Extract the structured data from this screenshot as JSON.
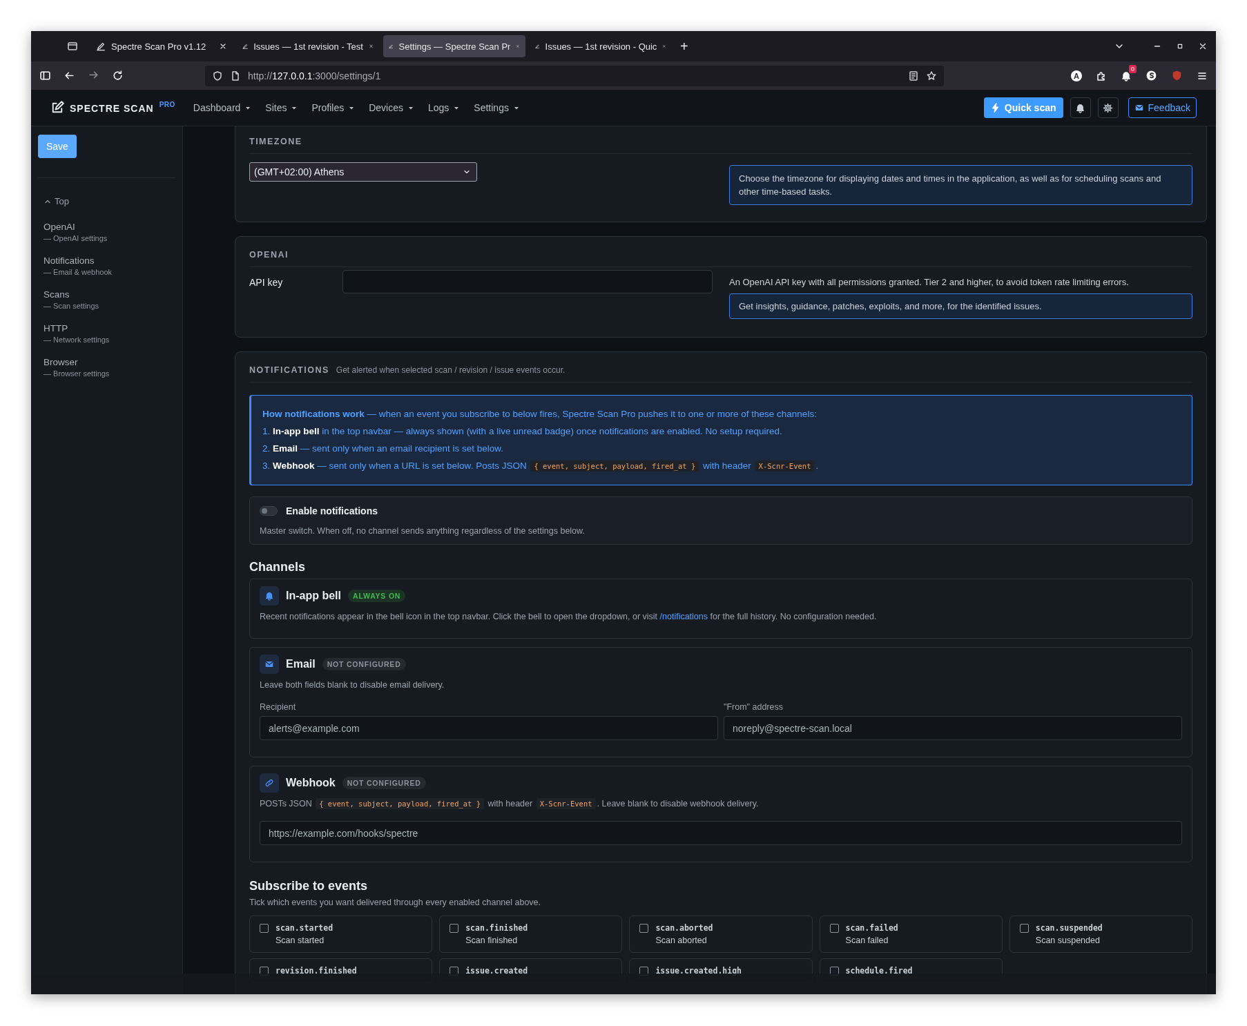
{
  "browser": {
    "tabs": [
      {
        "title": "Spectre Scan Pro v1.12",
        "selected": false
      },
      {
        "title": "Issues — 1st revision - Test",
        "selected": false
      },
      {
        "title": "Settings — Spectre Scan Pr",
        "selected": true
      },
      {
        "title": "Issues — 1st revision - Quic",
        "selected": false
      }
    ],
    "new_tab": "+",
    "url": {
      "scheme": "http://",
      "host": "127.0.0.1",
      "path": ":3000/settings/1"
    },
    "account_initial": "A",
    "extension_badge": "0"
  },
  "navbar": {
    "brand": "SPECTRE SCAN",
    "edition": "PRO",
    "menus": [
      "Dashboard",
      "Sites",
      "Profiles",
      "Devices",
      "Logs",
      "Settings"
    ],
    "quick_scan": "Quick scan",
    "feedback": "Feedback"
  },
  "sidebar": {
    "save": "Save",
    "top": "Top",
    "items": [
      {
        "title": "OpenAI",
        "subtitle": "— OpenAI settings"
      },
      {
        "title": "Notifications",
        "subtitle": "— Email & webhook"
      },
      {
        "title": "Scans",
        "subtitle": "— Scan settings"
      },
      {
        "title": "HTTP",
        "subtitle": "— Network settings"
      },
      {
        "title": "Browser",
        "subtitle": "— Browser settings"
      }
    ]
  },
  "timezone": {
    "heading": "TIMEZONE",
    "value": "(GMT+02:00) Athens",
    "help": "Choose the timezone for displaying dates and times in the application, as well as for scheduling scans and other time-based tasks."
  },
  "openai": {
    "heading": "OPENAI",
    "field_label": "API key",
    "hint": "An OpenAI API key with all permissions granted. Tier 2 and higher, to avoid token rate limiting errors.",
    "help": "Get insights, guidance, patches, exploits, and more, for the identified issues."
  },
  "notifications": {
    "heading": "NOTIFICATIONS",
    "subheading": "Get alerted when selected scan / revision / issue events occur.",
    "info": {
      "intro": "**How notifications work** — when an event you subscribe to below fires, Spectre Scan Pro pushes it to one or more of these channels:",
      "steps": [
        [
          {
            "kind": "text",
            "text": "1. **In-app bell** in the top navbar — always shown (with a live unread badge) once notifications are enabled. No setup required."
          }
        ],
        [
          {
            "kind": "text",
            "text": "2. **Email** — sent only when an email recipient is set below."
          }
        ],
        [
          {
            "kind": "text",
            "text": "3. **Webhook** — sent only when a URL is set below. Posts JSON "
          },
          {
            "kind": "code",
            "text": "{ event, subject, payload, fired_at }"
          },
          {
            "kind": "text",
            "text": " with header "
          },
          {
            "kind": "code",
            "text": "X-Scnr-Event"
          },
          {
            "kind": "text",
            "text": "."
          }
        ]
      ]
    },
    "enable": {
      "label": "Enable notifications",
      "on": false,
      "description": "Master switch. When off, no channel sends anything regardless of the settings below."
    },
    "channels_heading": "Channels",
    "channels": [
      {
        "kind": "bell",
        "name": "In-app bell",
        "badge": "ALWAYS ON",
        "active": true,
        "description": [
          {
            "kind": "text",
            "text": "Recent notifications appear in the bell icon in the top navbar. Click the bell to open the dropdown, or visit "
          },
          {
            "kind": "link",
            "text": "/notifications"
          },
          {
            "kind": "text",
            "text": " for the full history. No configuration needed."
          }
        ]
      },
      {
        "kind": "email",
        "name": "Email",
        "badge": "NOT CONFIGURED",
        "active": false,
        "description": [
          {
            "kind": "text",
            "text": "Leave both fields blank to disable email delivery."
          }
        ],
        "fields": [
          {
            "label": "Recipient",
            "placeholder": "alerts@example.com"
          },
          {
            "label": "\"From\" address",
            "placeholder": "noreply@spectre-scan.local"
          }
        ]
      },
      {
        "kind": "webhook",
        "name": "Webhook",
        "badge": "NOT CONFIGURED",
        "active": false,
        "description": [
          {
            "kind": "text",
            "text": "POSTs JSON "
          },
          {
            "kind": "code",
            "text": "{ event, subject, payload, fired_at }"
          },
          {
            "kind": "text",
            "text": " with header "
          },
          {
            "kind": "code",
            "text": "X-Scnr-Event"
          },
          {
            "kind": "text",
            "text": ". Leave blank to disable webhook delivery."
          }
        ],
        "fields": [
          {
            "placeholder": "https://example.com/hooks/spectre"
          }
        ]
      }
    ],
    "events_heading": "Subscribe to events",
    "events_description": "Tick which events you want delivered through every enabled channel above.",
    "events": [
      {
        "code": "scan.started",
        "label": "Scan started",
        "checked": false
      },
      {
        "code": "scan.finished",
        "label": "Scan finished",
        "checked": false
      },
      {
        "code": "scan.aborted",
        "label": "Scan aborted",
        "checked": false
      },
      {
        "code": "scan.failed",
        "label": "Scan failed",
        "checked": false
      },
      {
        "code": "scan.suspended",
        "label": "Scan suspended",
        "checked": false
      },
      {
        "code": "revision.finished",
        "checked": false
      },
      {
        "code": "issue.created",
        "checked": false
      },
      {
        "code": "issue.created.high",
        "checked": false
      },
      {
        "code": "schedule.fired",
        "checked": false
      }
    ]
  }
}
